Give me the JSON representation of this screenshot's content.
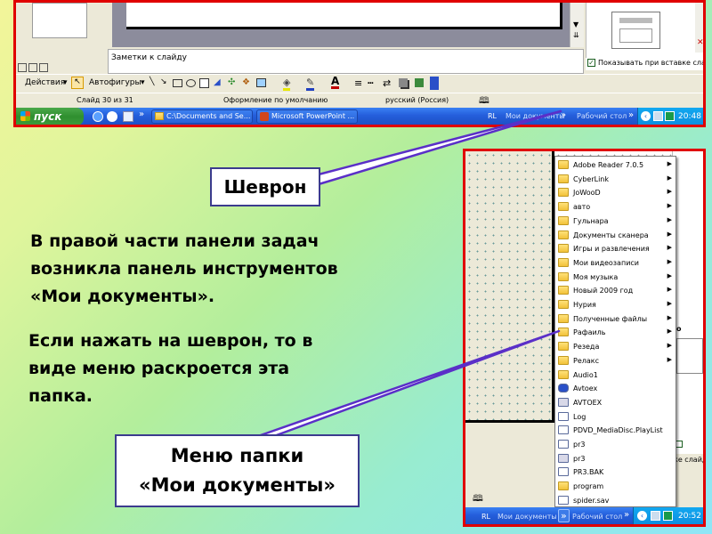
{
  "top_screenshot": {
    "notes_placeholder": "Заметки к слайду",
    "checkbox_label": "Показывать при вставке слайд",
    "drawing_toolbar": {
      "actions": "Действия",
      "autoshapes": "Автофигуры"
    },
    "status_bar": {
      "slide": "Слайд 30 из 31",
      "design": "Оформление по умолчанию",
      "language": "русский (Россия)"
    },
    "taskbar": {
      "start": "пуск",
      "tasks": [
        "C:\\Documents and Se...",
        "Microsoft PowerPoint ..."
      ],
      "toolbar_lang": "RL",
      "toolbar_name": "Мои документы",
      "desktop": "Рабочий стол",
      "clock": "20:48"
    }
  },
  "right_screenshot": {
    "taskbar": {
      "toolbar_lang": "RL",
      "toolbar_name": "Мои документы",
      "desktop": "Рабочий стол",
      "clock": "20:52"
    },
    "side_text_fragment": "ке слайд",
    "menu_items": [
      {
        "label": "Adobe Reader 7.0.5",
        "type": "folder",
        "submenu": true
      },
      {
        "label": "CyberLink",
        "type": "folder",
        "submenu": true
      },
      {
        "label": "JoWooD",
        "type": "folder",
        "submenu": true
      },
      {
        "label": "авто",
        "type": "folder",
        "submenu": true
      },
      {
        "label": "Гульнара",
        "type": "folder",
        "submenu": true
      },
      {
        "label": "Документы сканера",
        "type": "folder",
        "submenu": true
      },
      {
        "label": "Игры и развлечения",
        "type": "folder",
        "submenu": true
      },
      {
        "label": "Мои видеозаписи",
        "type": "folder",
        "submenu": true
      },
      {
        "label": "Моя музыка",
        "type": "folder",
        "submenu": true
      },
      {
        "label": "Новый 2009 год",
        "type": "folder",
        "submenu": true
      },
      {
        "label": "Нурия",
        "type": "folder",
        "submenu": true
      },
      {
        "label": "Полученные файлы",
        "type": "folder",
        "submenu": true
      },
      {
        "label": "Рафаиль",
        "type": "folder",
        "submenu": true
      },
      {
        "label": "Резеда",
        "type": "folder",
        "submenu": true
      },
      {
        "label": "Релакс",
        "type": "folder",
        "submenu": true
      },
      {
        "label": "Audio1",
        "type": "folder",
        "submenu": false
      },
      {
        "label": "Avtoex",
        "type": "car",
        "submenu": false
      },
      {
        "label": "AVTOEX",
        "type": "app",
        "submenu": false
      },
      {
        "label": "Log",
        "type": "doc",
        "submenu": false
      },
      {
        "label": "PDVD_MediaDisc.PlayList",
        "type": "doc",
        "submenu": false
      },
      {
        "label": "pr3",
        "type": "doc",
        "submenu": false
      },
      {
        "label": "pr3",
        "type": "app",
        "submenu": false
      },
      {
        "label": "PR3.BAK",
        "type": "doc",
        "submenu": false
      },
      {
        "label": "program",
        "type": "folder",
        "submenu": false
      },
      {
        "label": "spider.sav",
        "type": "doc",
        "submenu": false
      }
    ]
  },
  "callouts": {
    "chevron": "Шеврон",
    "menu_line1": "Меню папки",
    "menu_line2": "«Мои документы»"
  },
  "paragraphs": {
    "p1_line1": "В правой части панели задач",
    "p1_line2": "возникла панель инструментов",
    "p1_line3": "«Мои документы».",
    "p2_line1": "Если нажать на шеврон, то в",
    "p2_line2": "виде меню раскроется эта",
    "p2_line3": "папка."
  },
  "colors": {
    "frame_border": "#e00000",
    "callout_line": "#5a2fc8",
    "taskbar_blue": "#245edb",
    "start_green": "#3c9c3c"
  }
}
